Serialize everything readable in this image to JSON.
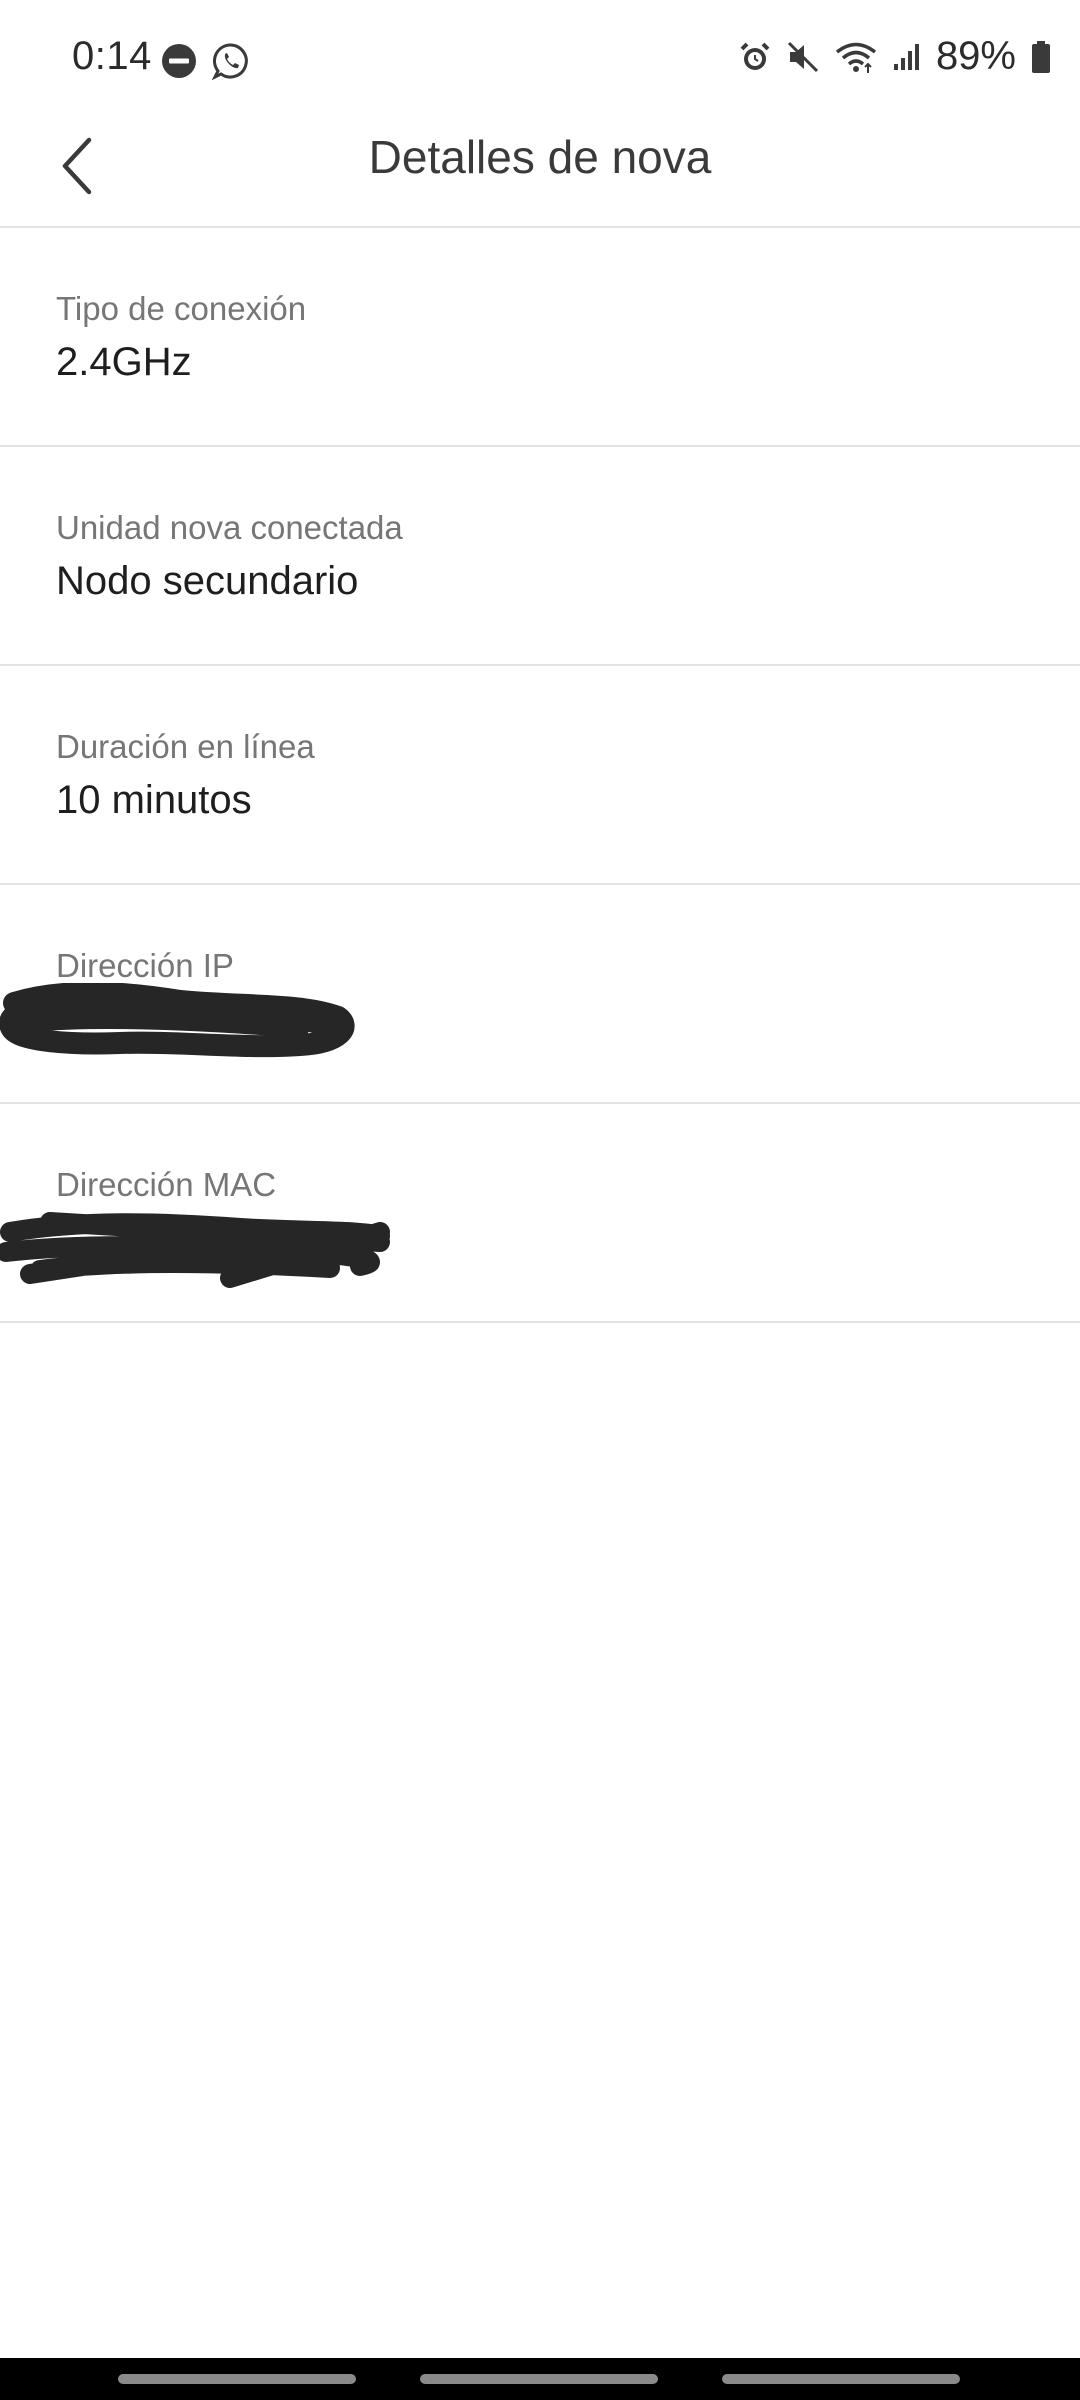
{
  "status_bar": {
    "time": "0:14",
    "battery": "89%",
    "left_icons": [
      "do-not-disturb-icon",
      "whatsapp-icon"
    ],
    "right_icons": [
      "alarm-icon",
      "mute-icon",
      "wifi-icon",
      "signal-icon",
      "battery-icon"
    ]
  },
  "header": {
    "title": "Detalles de nova",
    "back_icon": "chevron-left-icon"
  },
  "details": [
    {
      "label": "Tipo de conexión",
      "value": "2.4GHz"
    },
    {
      "label": "Unidad nova conectada",
      "value": "Nodo secundario"
    },
    {
      "label": "Duración en línea",
      "value": "10 minutos"
    },
    {
      "label": "Dirección IP",
      "value": ""
    },
    {
      "label": "Dirección MAC",
      "value": ""
    }
  ],
  "colors": {
    "text_primary": "#1e1e1e",
    "text_secondary": "#767676",
    "divider": "#e3e3e3",
    "background": "#ffffff"
  }
}
